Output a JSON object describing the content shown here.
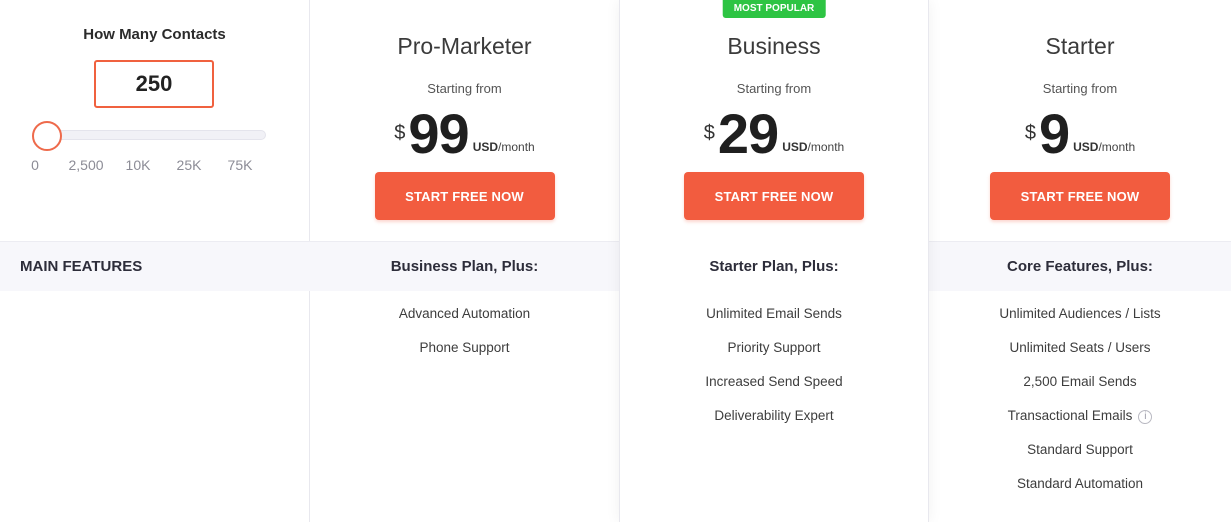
{
  "contacts": {
    "title": "How Many Contacts",
    "value": "250",
    "slider_labels": [
      "0",
      "2,500",
      "10K",
      "25K",
      "75K"
    ]
  },
  "main_features_label": "MAIN FEATURES",
  "plans": [
    {
      "name": "Pro-Marketer",
      "starting_label": "Starting from",
      "currency": "$",
      "amount": "99",
      "unit_currency": "USD",
      "unit_period": "/month",
      "cta": "START FREE NOW",
      "plus_heading": "Business Plan, Plus:",
      "features": [
        "Advanced Automation",
        "Phone Support"
      ]
    },
    {
      "name": "Business",
      "badge": "MOST POPULAR",
      "starting_label": "Starting from",
      "currency": "$",
      "amount": "29",
      "unit_currency": "USD",
      "unit_period": "/month",
      "cta": "START FREE NOW",
      "plus_heading": "Starter Plan, Plus:",
      "features": [
        "Unlimited Email Sends",
        "Priority Support",
        "Increased Send Speed",
        "Deliverability Expert"
      ]
    },
    {
      "name": "Starter",
      "starting_label": "Starting from",
      "currency": "$",
      "amount": "9",
      "unit_currency": "USD",
      "unit_period": "/month",
      "cta": "START FREE NOW",
      "plus_heading": "Core Features, Plus:",
      "features": [
        "Unlimited Audiences / Lists",
        "Unlimited Seats / Users",
        "2,500 Email Sends",
        "Transactional Emails",
        "Standard Support",
        "Standard Automation"
      ]
    }
  ],
  "colors": {
    "accent": "#f25c3f",
    "badge": "#2dc443",
    "band": "#f7f7fb"
  },
  "icons": {
    "transactional_info": "info-icon"
  }
}
